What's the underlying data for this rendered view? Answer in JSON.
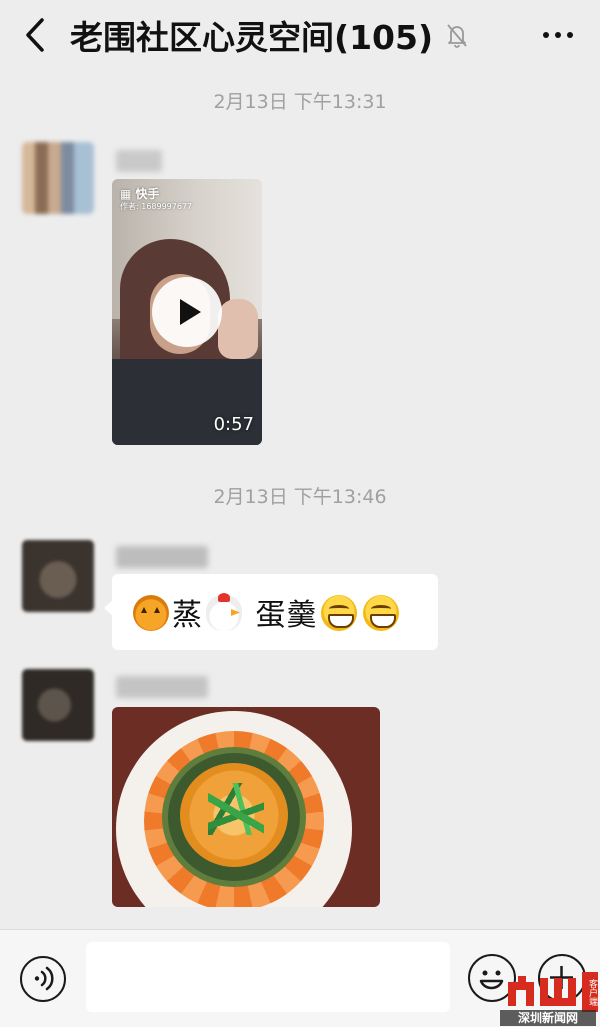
{
  "header": {
    "title": "老围社区心灵空间(105)"
  },
  "messages": [
    {
      "timestamp": "2月13日 下午13:31",
      "type": "video",
      "video": {
        "platform": "快手",
        "author_id": "作者: 1689997677",
        "duration": "0:57"
      }
    },
    {
      "timestamp": "2月13日 下午13:46",
      "type": "text",
      "text_parts": [
        "蒸",
        "蛋羹"
      ]
    },
    {
      "type": "image"
    }
  ],
  "input_bar": {
    "placeholder": ""
  },
  "watermark": {
    "brand_text": "深圳新闻网",
    "side_text": "客户端"
  },
  "colors": {
    "background": "#ededed",
    "bubble": "#ffffff",
    "timestamp": "#a0a0a0",
    "watermark_red": "#d62b1e"
  },
  "icons": [
    "back-icon",
    "mute-bell-icon",
    "more-icon",
    "play-icon",
    "voice-icon",
    "emoji-icon",
    "plus-icon"
  ]
}
